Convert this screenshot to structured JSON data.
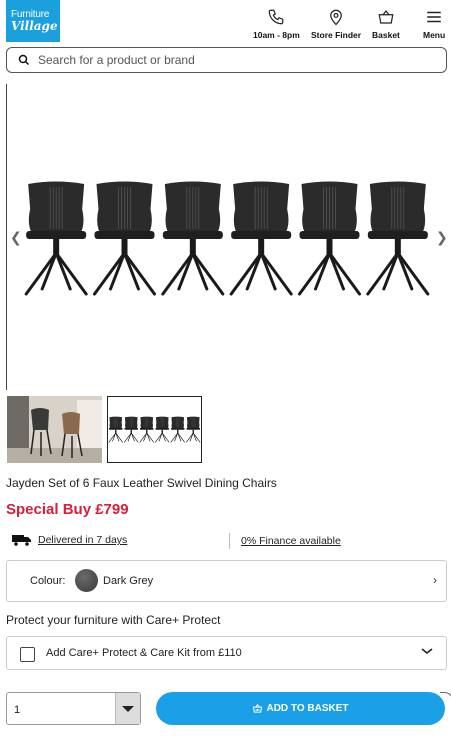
{
  "header": {
    "logo_line1": "Furniture",
    "logo_line2": "Village",
    "hours_label": "10am - 8pm",
    "store_finder_label": "Store Finder",
    "basket_label": "Basket",
    "menu_label": "Menu"
  },
  "search": {
    "placeholder": "Search for a product or brand"
  },
  "product": {
    "title": "Jayden Set of 6 Faux Leather Swivel Dining Chairs",
    "price": "Special Buy £799",
    "delivery": "Delivered in 7 days",
    "finance": "0% Finance available",
    "colour_label": "Colour:",
    "colour_value": "Dark Grey",
    "chair_count": 6
  },
  "care": {
    "heading": "Protect your furniture with Care+ Protect",
    "option_label": "Add Care+ Protect & Care Kit from £110"
  },
  "purchase": {
    "quantity": "1",
    "add_to_basket": "ADD TO BASKET"
  },
  "colors": {
    "brand_blue": "#1aa0dc",
    "price_red": "#d6203a",
    "button_blue": "#1aa0e6"
  }
}
